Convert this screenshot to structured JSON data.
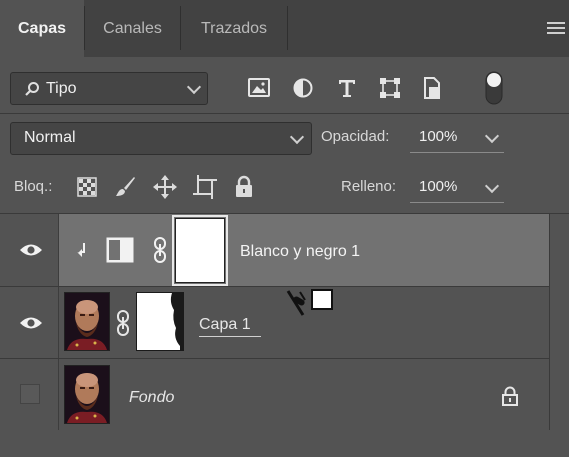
{
  "tabs": [
    {
      "label": "Capas",
      "active": true
    },
    {
      "label": "Canales",
      "active": false
    },
    {
      "label": "Trazados",
      "active": false
    }
  ],
  "filter": {
    "kind_value": "Tipo"
  },
  "filter_icons": [
    "image-filter-icon",
    "adjustment-filter-icon",
    "type-filter-icon",
    "shape-filter-icon",
    "smart-object-filter-icon",
    "filter-toggle-icon"
  ],
  "blend": {
    "mode": "Normal",
    "opacity_label": "Opacidad:",
    "opacity_value": "100%"
  },
  "lock": {
    "label": "Bloq.:",
    "fill_label": "Relleno:",
    "fill_value": "100%"
  },
  "lock_icons": [
    "lock-transparent-pixels-icon",
    "lock-image-pixels-icon",
    "lock-position-icon",
    "lock-artboard-icon",
    "lock-all-icon"
  ],
  "layers": [
    {
      "name": "Blanco y negro 1",
      "selected": true,
      "visible": true,
      "type": "adjustment"
    },
    {
      "name": "Capa 1",
      "selected": false,
      "visible": true,
      "type": "pixel-with-mask"
    },
    {
      "name": "Fondo",
      "selected": false,
      "visible": false,
      "type": "background",
      "locked": true
    }
  ],
  "colors": {
    "panel": "#535353",
    "tabbar": "#424242",
    "selected_row": "#727272",
    "field": "#454545"
  }
}
